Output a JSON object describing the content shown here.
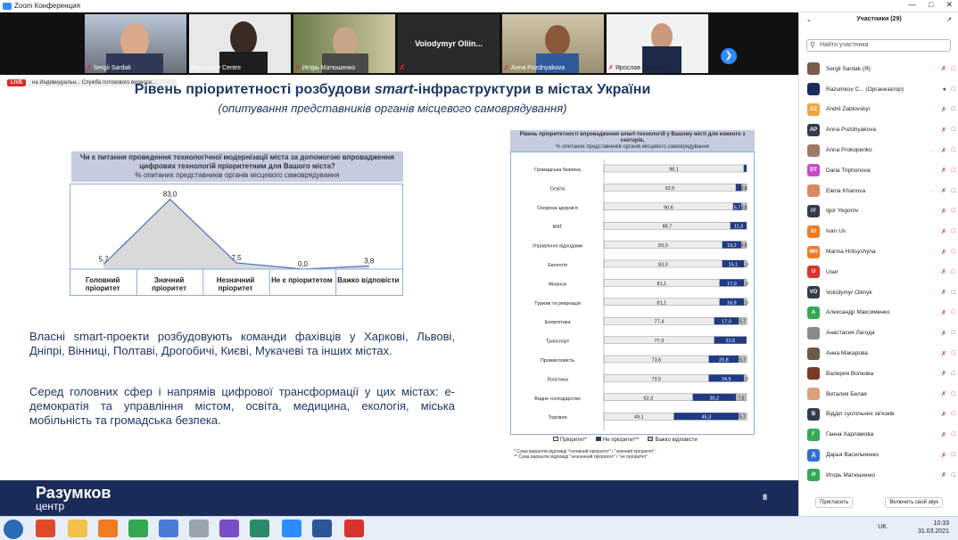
{
  "window": {
    "title": "Zoom Конференция"
  },
  "video_strip": {
    "tiles": [
      {
        "name": "Sergii Sardak"
      },
      {
        "name": "Razumkov Centre"
      },
      {
        "name": "Игорь Матюшенко"
      },
      {
        "name": "Volodymyr Oliin..."
      },
      {
        "name": "Anna Pozdnyakova"
      },
      {
        "name": "Ярослав Жалило"
      }
    ]
  },
  "slide": {
    "live_badge": "LIVE",
    "recording_text": "на Индивидуальн... Служба потокового видеосе...",
    "title_prefix": "Рівень пріоритетності розбудови ",
    "title_smart": "smart",
    "title_suffix": "-інфраструктури в містах України",
    "subtitle": "(опитування представників органів місцевого самоврядування)",
    "left_chart": {
      "question": "Чи є питання проведення технологічної модернізації міста за допомогою впровадження цифрових технологій пріоритетним для Вашого міста?",
      "note": "% опитаних представників органів місцевого самоврядування"
    },
    "para1": "Власні smart-проекти розбудовують команди фахівців у Харкові, Львові, Дніпрі, Вінниці, Полтаві, Дрогобичі, Києві, Мукачеві та інших містах.",
    "para2": "Серед головних сфер і напрямів цифрової трансформації у цих містах: e-демократія та управління містом, освіта, медицина, екологія, міська мобільність та громадська безпека.",
    "right_chart": {
      "title": "Рівень пріоритетності впровадження smart-технологій у Вашому місті для кожного з секторів,",
      "note": "% опитаних представників органів місцевого самоврядування",
      "legend": [
        "Пріоритет*",
        "Не пріоритет**",
        "Важко відповісти"
      ],
      "footnote1": "* Сума варіантів відповіді \"головний пріоритет\" і \"значний пріоритет\".",
      "footnote2": "** Сума варіантів відповіді \"незначний пріоритет\" і \"не пріоритет\"."
    },
    "footer": {
      "brand": "Разумков",
      "brand_sub": "центр",
      "page": "8"
    }
  },
  "chart_data": [
    {
      "type": "area",
      "categories": [
        "Головний пріоритет",
        "Значний пріоритет",
        "Незначний пріоритет",
        "Не є пріоритетом",
        "Важко відповісти"
      ],
      "values": [
        5.7,
        83.0,
        7.5,
        0.0,
        3.8
      ],
      "title": "Чи є питання проведення технологічної модернізації міста за допомогою впровадження цифрових технологій пріоритетним для Вашого міста?",
      "ylim": [
        0,
        90
      ]
    },
    {
      "type": "bar",
      "orientation": "horizontal",
      "stacked": true,
      "categories": [
        "Громадська безпека",
        "Освіта",
        "Охорона здоров'я",
        "ЖКГ",
        "Управління відходами",
        "Екологія",
        "Фінанси",
        "Туризм та рекреація",
        "Енергетика",
        "Транспорт",
        "Промисловість",
        "Логістика",
        "Водне господарство",
        "Торгівля"
      ],
      "series": [
        {
          "name": "Пріоритет*",
          "values": [
            98.1,
            92.5,
            90.6,
            88.7,
            83.0,
            83.0,
            81.1,
            81.1,
            77.4,
            77.3,
            73.6,
            73.5,
            62.3,
            49.1
          ]
        },
        {
          "name": "Не пріоритет**",
          "values": [
            1.9,
            3.8,
            5.7,
            11.3,
            13.2,
            15.1,
            17.0,
            16.9,
            17.0,
            22.6,
            20.8,
            24.5,
            30.2,
            45.3
          ]
        },
        {
          "name": "Важко відповісти",
          "values": [
            0.0,
            3.8,
            3.8,
            0.0,
            3.8,
            1.9,
            1.9,
            2.0,
            5.7,
            0.0,
            5.7,
            2.0,
            7.5,
            5.7
          ]
        }
      ],
      "xlim": [
        0,
        100
      ],
      "colors": [
        "#ececec",
        "#1f3b86",
        "#bfbfbf"
      ]
    }
  ],
  "participants": {
    "header": "Участники (29)",
    "search_placeholder": "Найти участника",
    "list": [
      {
        "initials": "",
        "color": "#7a5c4a",
        "name": "Sergii Sardak (Я)"
      },
      {
        "initials": "",
        "color": "#1a2b5a",
        "name": "Razumkov C... (Организатор)"
      },
      {
        "initials": "AZ",
        "color": "#f0a53c",
        "name": "Andrii Zablovskyi"
      },
      {
        "initials": "AP",
        "color": "#333d4a",
        "name": "Anna Pozdnyakova"
      },
      {
        "initials": "",
        "color": "#9c7a66",
        "name": "Anna Prokopenko"
      },
      {
        "initials": "DT",
        "color": "#c64bc3",
        "name": "Daria Triphonova"
      },
      {
        "initials": "",
        "color": "#d68b66",
        "name": "Elena Khanova"
      },
      {
        "initials": "IY",
        "color": "#333d4a",
        "name": "Igor Yegorov"
      },
      {
        "initials": "IU",
        "color": "#ef7b24",
        "name": "Ivan Us"
      },
      {
        "initials": "MH",
        "color": "#ef7b24",
        "name": "Marina Hritsyshyna"
      },
      {
        "initials": "U",
        "color": "#d9332f",
        "name": "User"
      },
      {
        "initials": "VO",
        "color": "#333d4a",
        "name": "Volodymyr Oliinyk"
      },
      {
        "initials": "А",
        "color": "#34a853",
        "name": "Александр Максименко"
      },
      {
        "initials": "",
        "color": "#8a8a8a",
        "name": "Анастасия Лагода"
      },
      {
        "initials": "",
        "color": "#6b5a4a",
        "name": "Анна Макарова"
      },
      {
        "initials": "",
        "color": "#7a3a2a",
        "name": "Валерия Волкова"
      },
      {
        "initials": "",
        "color": "#d9a07a",
        "name": "Виталия Белая"
      },
      {
        "initials": "В",
        "color": "#333d4a",
        "name": "Відділ суспільних зв'язків"
      },
      {
        "initials": "Г",
        "color": "#34a853",
        "name": "Ганна Харламова"
      },
      {
        "initials": "Д",
        "color": "#2d6fd6",
        "name": "Дарья Васильченко"
      },
      {
        "initials": "И",
        "color": "#34a853",
        "name": "Игорь Матюшенко"
      }
    ],
    "invite_button": "Пригласить",
    "unmute_button": "Включить свой звук"
  },
  "taskbar": {
    "lang": "UK",
    "time": "10:33",
    "date": "31.03.2021"
  }
}
